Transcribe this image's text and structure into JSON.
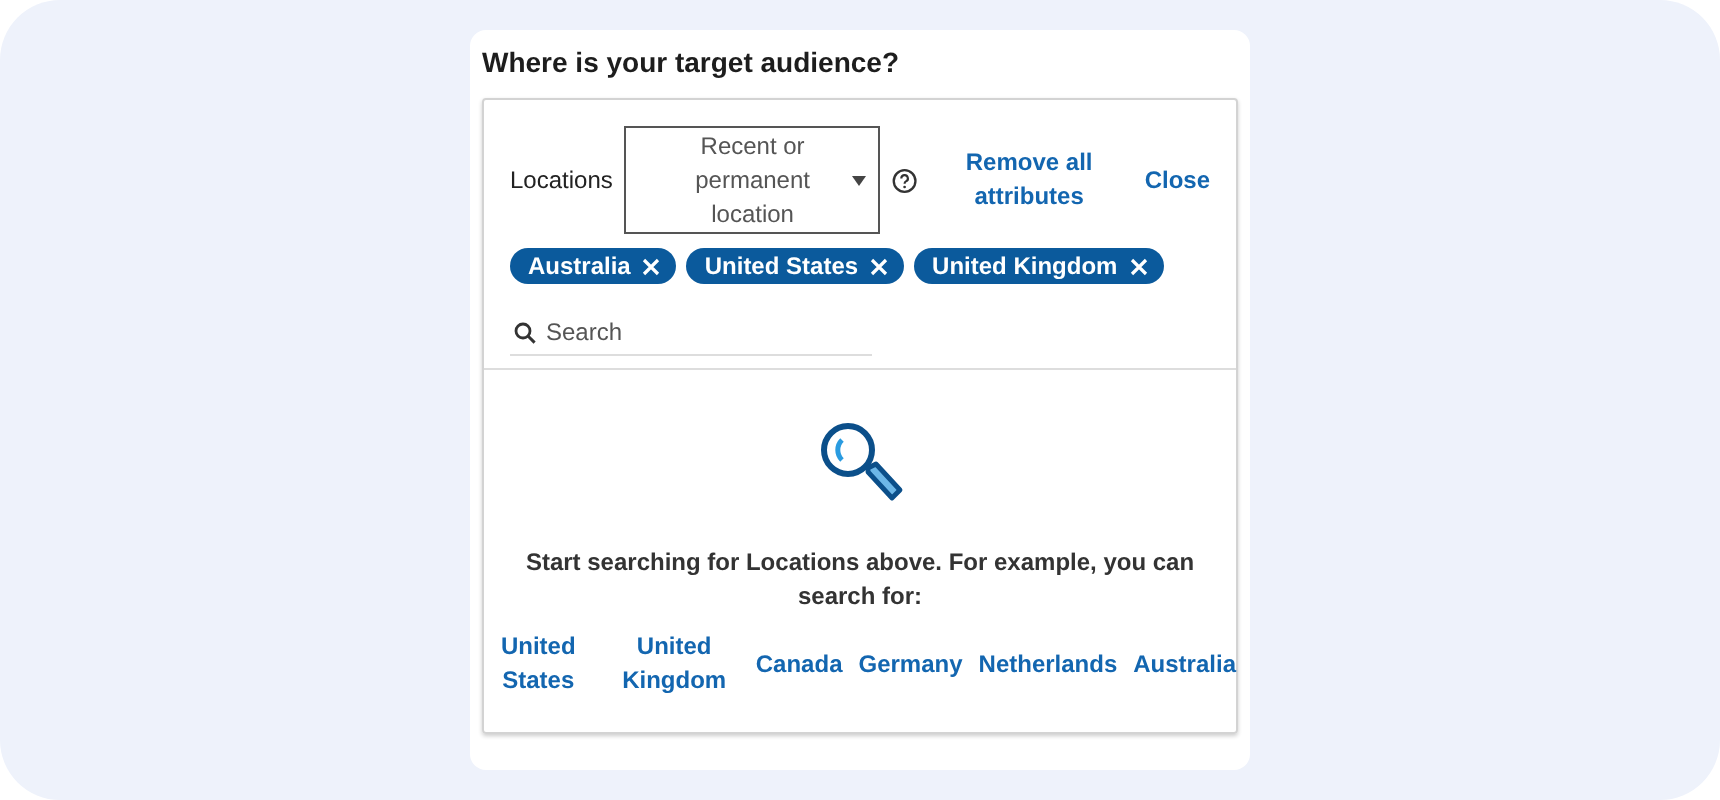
{
  "title": "Where is your target audience?",
  "filter": {
    "label": "Locations",
    "dropdown": "Recent or permanent location",
    "remove_all": "Remove all attributes",
    "close": "Close"
  },
  "chips": [
    "Australia",
    "United States",
    "United Kingdom"
  ],
  "search": {
    "placeholder": "Search"
  },
  "empty_state": {
    "message": "Start searching for Locations above. For example, you can search for:",
    "suggestions": [
      "United States",
      "United Kingdom",
      "Canada",
      "Germany",
      "Netherlands",
      "Australia"
    ]
  }
}
